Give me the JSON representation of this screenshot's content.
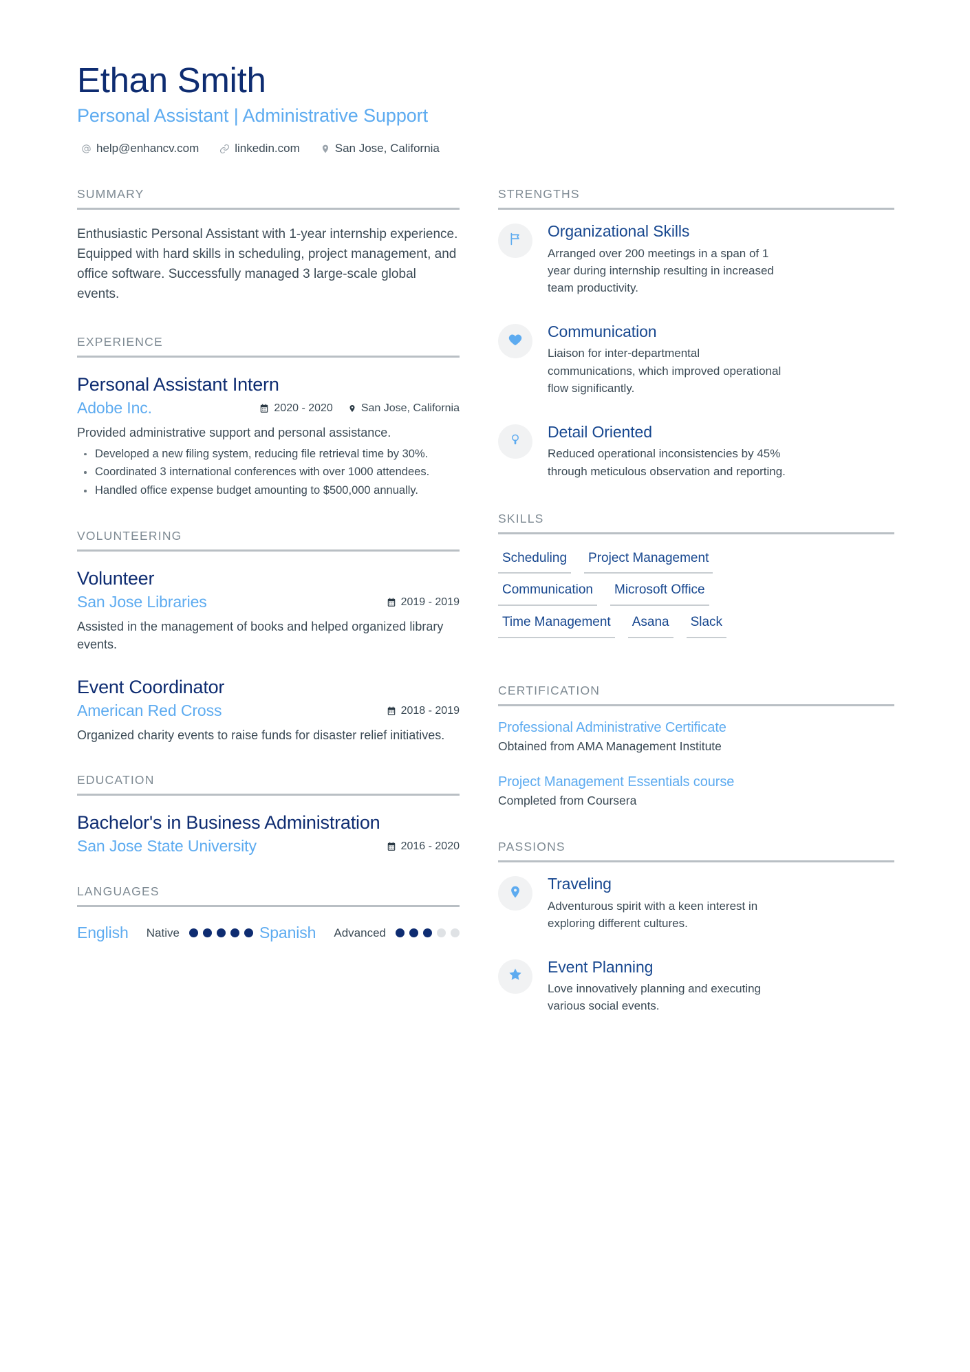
{
  "header": {
    "name": "Ethan Smith",
    "title": "Personal Assistant | Administrative Support",
    "contacts": [
      {
        "icon": "at-sign-icon",
        "text": "help@enhancv.com"
      },
      {
        "icon": "link-icon",
        "text": "linkedin.com"
      },
      {
        "icon": "location-pin-icon",
        "text": "San Jose, California"
      }
    ]
  },
  "colors": {
    "navy": "#0e2c71",
    "accent_blue": "#5dabf0",
    "link_blue": "#17478f",
    "body_text": "#3b4a55",
    "heading_grey": "#7e8a93",
    "rule_grey": "#b9bfc4",
    "badge_bg": "#f1f2f3",
    "dot_off": "#dfe2e5"
  },
  "summary": {
    "heading": "SUMMARY",
    "text": "Enthusiastic Personal Assistant with 1-year internship experience. Equipped with hard skills in scheduling, project management, and office software. Successfully managed 3 large-scale global events."
  },
  "experience": {
    "heading": "EXPERIENCE",
    "entries": [
      {
        "title": "Personal Assistant Intern",
        "organization": "Adobe Inc.",
        "dates": "2020 - 2020",
        "location": "San Jose, California",
        "description": "Provided administrative support and personal assistance.",
        "bullets": [
          "Developed a new filing system, reducing file retrieval time by 30%.",
          "Coordinated 3 international conferences with over 1000 attendees.",
          "Handled office expense budget amounting to $500,000 annually."
        ]
      }
    ]
  },
  "volunteering": {
    "heading": "VOLUNTEERING",
    "entries": [
      {
        "title": "Volunteer",
        "organization": "San Jose Libraries",
        "dates": "2019 - 2019",
        "description": "Assisted in the management of books and helped organized library events."
      },
      {
        "title": "Event Coordinator",
        "organization": "American Red Cross",
        "dates": "2018 - 2019",
        "description": "Organized charity events to raise funds for disaster relief initiatives."
      }
    ]
  },
  "education": {
    "heading": "EDUCATION",
    "entries": [
      {
        "title": "Bachelor's in Business Administration",
        "organization": "San Jose State University",
        "dates": "2016 - 2020"
      }
    ]
  },
  "languages": {
    "heading": "LANGUAGES",
    "items": [
      {
        "name": "English",
        "level": "Native",
        "filled": 5,
        "total": 5
      },
      {
        "name": "Spanish",
        "level": "Advanced",
        "filled": 3,
        "total": 5
      }
    ]
  },
  "strengths": {
    "heading": "STRENGTHS",
    "items": [
      {
        "icon": "flag-icon",
        "title": "Organizational Skills",
        "description": "Arranged over 200 meetings in a span of 1 year during internship resulting in increased team productivity."
      },
      {
        "icon": "heart-icon",
        "title": "Communication",
        "description": "Liaison for inter-departmental communications, which improved operational flow significantly."
      },
      {
        "icon": "lightbulb-icon",
        "title": "Detail Oriented",
        "description": "Reduced operational inconsistencies by 45% through meticulous observation and reporting."
      }
    ]
  },
  "skills": {
    "heading": "SKILLS",
    "items": [
      "Scheduling",
      "Project Management",
      "Communication",
      "Microsoft Office",
      "Time Management",
      "Asana",
      "Slack"
    ]
  },
  "certification": {
    "heading": "CERTIFICATION",
    "items": [
      {
        "title": "Professional Administrative Certificate",
        "subtitle": "Obtained from AMA Management Institute"
      },
      {
        "title": "Project Management Essentials course",
        "subtitle": "Completed from Coursera"
      }
    ]
  },
  "passions": {
    "heading": "PASSIONS",
    "items": [
      {
        "icon": "location-pin-icon",
        "title": "Traveling",
        "description": "Adventurous spirit with a keen interest in exploring different cultures."
      },
      {
        "icon": "star-icon",
        "title": "Event Planning",
        "description": "Love innovatively planning and executing various social events."
      }
    ]
  }
}
